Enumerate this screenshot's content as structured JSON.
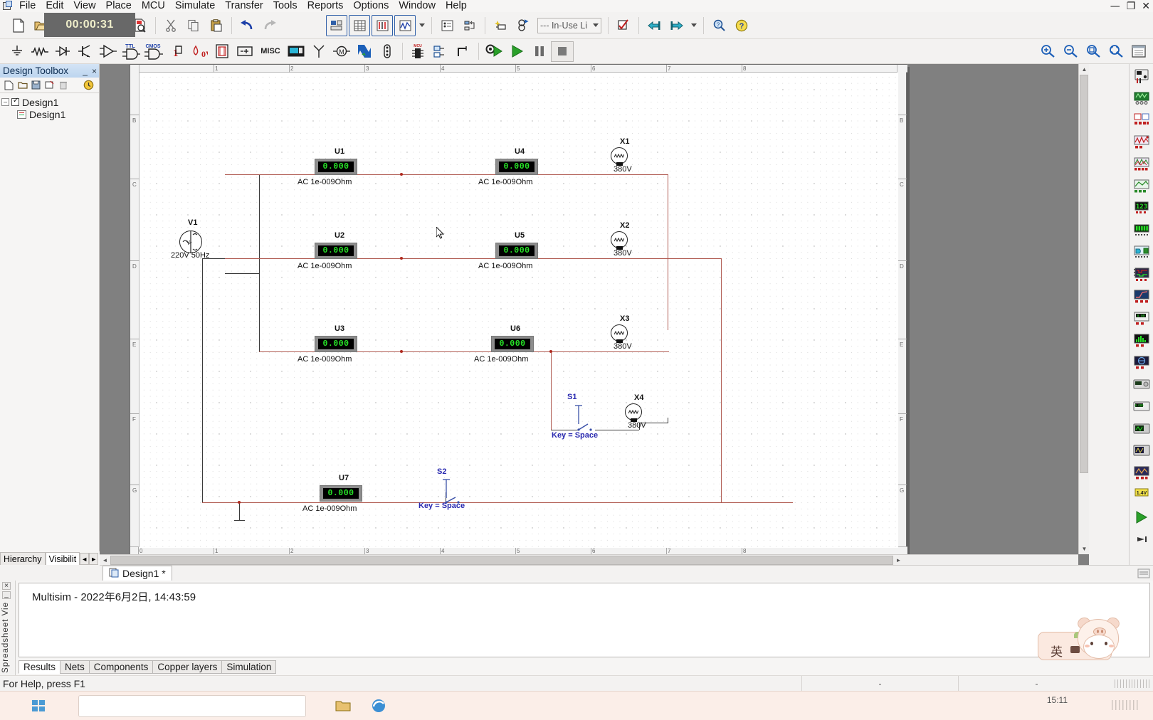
{
  "app": {
    "title": "Multisim",
    "icon": "multisim-app-icon"
  },
  "menu": {
    "items": [
      {
        "label": "File"
      },
      {
        "label": "Edit"
      },
      {
        "label": "View"
      },
      {
        "label": "Place"
      },
      {
        "label": "MCU"
      },
      {
        "label": "Simulate"
      },
      {
        "label": "Transfer"
      },
      {
        "label": "Tools"
      },
      {
        "label": "Reports"
      },
      {
        "label": "Options"
      },
      {
        "label": "Window"
      },
      {
        "label": "Help"
      }
    ]
  },
  "window_controls": {
    "minimize": "—",
    "restore": "❐",
    "close": "✕"
  },
  "timer": {
    "value": "00:00:31"
  },
  "toolbar_main": {
    "buttons": [
      {
        "name": "new-file",
        "icon": "new-document-icon"
      },
      {
        "name": "open-file",
        "icon": "open-folder-icon"
      },
      {
        "name": "open-samples",
        "icon": "open-samples-icon"
      },
      {
        "name": "save-file",
        "icon": "save-disk-icon"
      },
      {
        "name": "print",
        "icon": "printer-icon"
      },
      {
        "name": "print-preview",
        "icon": "print-preview-icon"
      },
      {
        "name": "cut",
        "icon": "scissors-icon"
      },
      {
        "name": "copy",
        "icon": "copy-icon"
      },
      {
        "name": "paste",
        "icon": "clipboard-paste-icon"
      },
      {
        "name": "undo",
        "icon": "undo-arrow-icon"
      },
      {
        "name": "redo",
        "icon": "redo-arrow-icon"
      },
      {
        "name": "toggle-design-toolbox",
        "icon": "design-toolbox-icon"
      },
      {
        "name": "toggle-spreadsheet-view",
        "icon": "spreadsheet-grid-icon"
      },
      {
        "name": "database-manager",
        "icon": "db-manager-icon"
      },
      {
        "name": "grapher",
        "icon": "grapher-waveform-icon"
      },
      {
        "name": "grapher-dropdown",
        "icon": "chevron-down-icon"
      },
      {
        "name": "postprocessor",
        "icon": "postprocessor-icon"
      },
      {
        "name": "electrical-rules-check",
        "icon": "erc-check-icon"
      },
      {
        "name": "back-annotate",
        "icon": "back-annotate-icon"
      },
      {
        "name": "create-component",
        "icon": "create-component-icon"
      },
      {
        "name": "in-use-list",
        "icon": "in-use-list-icon"
      },
      {
        "name": "help-search",
        "icon": "help-search-icon"
      }
    ],
    "in_use_list": {
      "value": "--- In-Use Li",
      "placeholder": "--- In-Use List ---"
    },
    "zoom": {
      "zoom_in": "zoom-in-icon",
      "zoom_out": "zoom-out-icon",
      "zoom_area": "zoom-area-icon",
      "zoom_fit": "zoom-fit-icon",
      "fullscreen": "fullscreen-icon"
    }
  },
  "toolbar_components": {
    "buttons": [
      {
        "name": "place-source",
        "icon": "source-ground-icon",
        "label": ""
      },
      {
        "name": "place-basic",
        "icon": "resistor-icon",
        "label": ""
      },
      {
        "name": "place-diode",
        "icon": "diode-icon",
        "label": ""
      },
      {
        "name": "place-transistor",
        "icon": "transistor-icon",
        "label": ""
      },
      {
        "name": "place-analog",
        "icon": "opamp-icon",
        "label": ""
      },
      {
        "name": "place-ttl",
        "icon": "ttl-gate-icon",
        "label": "TTL"
      },
      {
        "name": "place-cmos",
        "icon": "cmos-gate-icon",
        "label": "CMOS"
      },
      {
        "name": "place-misc-digital",
        "icon": "misc-digital-icon",
        "label": ""
      },
      {
        "name": "place-mixed",
        "icon": "mixed-component-icon",
        "label": "0V"
      },
      {
        "name": "place-indicator",
        "icon": "indicator-icon",
        "label": ""
      },
      {
        "name": "place-power",
        "icon": "power-source-icon",
        "label": ""
      },
      {
        "name": "place-misc",
        "icon": "misc-icon",
        "label": "MISC"
      },
      {
        "name": "place-advanced-peripherals",
        "icon": "peripherals-icon",
        "label": ""
      },
      {
        "name": "place-rf",
        "icon": "antenna-icon",
        "label": ""
      },
      {
        "name": "place-electromechanical",
        "icon": "motor-icon",
        "label": ""
      },
      {
        "name": "place-ni-components",
        "icon": "ni-logo-icon",
        "label": ""
      },
      {
        "name": "place-connectors",
        "icon": "connector-icon",
        "label": ""
      },
      {
        "name": "place-mcu",
        "icon": "mcu-chip-icon",
        "label": "MCU"
      },
      {
        "name": "place-hierarchical-block",
        "icon": "hierarchical-block-icon",
        "label": ""
      },
      {
        "name": "place-bus",
        "icon": "bus-icon",
        "label": ""
      },
      {
        "name": "simulation-settings",
        "icon": "simulate-settings-icon",
        "label": ""
      },
      {
        "name": "run-simulation",
        "icon": "run-play-icon",
        "label": ""
      },
      {
        "name": "pause-simulation",
        "icon": "pause-icon",
        "label": ""
      },
      {
        "name": "stop-simulation",
        "icon": "stop-icon",
        "label": ""
      }
    ]
  },
  "design_toolbox": {
    "title": "Design Toolbox",
    "tools": [
      {
        "name": "new-sheet",
        "icon": "new-sheet-icon"
      },
      {
        "name": "open-sheet",
        "icon": "open-sheet-icon"
      },
      {
        "name": "save-sheet",
        "icon": "save-sheet-icon"
      },
      {
        "name": "rename-sheet",
        "icon": "rename-sheet-icon"
      },
      {
        "name": "delete-sheet",
        "icon": "delete-sheet-icon"
      },
      {
        "name": "sheet-properties",
        "icon": "sheet-properties-icon"
      }
    ],
    "tree": [
      {
        "label": "Design1",
        "level": 0,
        "checked": true
      },
      {
        "label": "Design1",
        "level": 1,
        "checked": false
      }
    ],
    "tabs": [
      {
        "label": "Hierarchy",
        "active": false
      },
      {
        "label": "Visibilit",
        "active": true
      }
    ],
    "collapse_button": "_",
    "close_button": "×"
  },
  "schematic": {
    "ruler_top": [
      "1",
      "2",
      "3",
      "4",
      "5",
      "6",
      "7",
      "8"
    ],
    "ruler_bottom": [
      "0",
      "1",
      "2",
      "3",
      "4",
      "5",
      "6",
      "7",
      "8"
    ],
    "ruler_left": [
      "B",
      "C",
      "D",
      "E",
      "F",
      "G"
    ],
    "ruler_right": [
      "B",
      "C",
      "D",
      "E",
      "F",
      "G"
    ],
    "components": [
      {
        "name": "V1",
        "ref": "V1",
        "value": "220V 50Hz",
        "type": "ac-source"
      },
      {
        "name": "U1",
        "ref": "U1",
        "display": "0.000",
        "value": "AC  1e-009Ohm",
        "type": "multimeter"
      },
      {
        "name": "U2",
        "ref": "U2",
        "display": "0.000",
        "value": "AC  1e-009Ohm",
        "type": "multimeter"
      },
      {
        "name": "U3",
        "ref": "U3",
        "display": "0.000",
        "value": "AC  1e-009Ohm",
        "type": "multimeter"
      },
      {
        "name": "U4",
        "ref": "U4",
        "display": "0.000",
        "value": "AC  1e-009Ohm",
        "type": "multimeter"
      },
      {
        "name": "U5",
        "ref": "U5",
        "display": "0.000",
        "value": "AC  1e-009Ohm",
        "type": "multimeter"
      },
      {
        "name": "U6",
        "ref": "U6",
        "display": "0.000",
        "value": "AC  1e-009Ohm",
        "type": "multimeter"
      },
      {
        "name": "U7",
        "ref": "U7",
        "display": "0.000",
        "value": "AC  1e-009Ohm",
        "type": "multimeter"
      },
      {
        "name": "X1",
        "ref": "X1",
        "value": "380V",
        "type": "lamp"
      },
      {
        "name": "X2",
        "ref": "X2",
        "value": "380V",
        "type": "lamp"
      },
      {
        "name": "X3",
        "ref": "X3",
        "value": "380V",
        "type": "lamp"
      },
      {
        "name": "X4",
        "ref": "X4",
        "value": "380V",
        "type": "lamp"
      },
      {
        "name": "S1",
        "ref": "S1",
        "value": "Key = Space",
        "type": "switch"
      },
      {
        "name": "S2",
        "ref": "S2",
        "value": "Key = Space",
        "type": "switch"
      }
    ],
    "colors": {
      "wire": "#b05b52",
      "wire_dark": "#3a3a3a",
      "meter_display_text": "#27e327",
      "meter_display_bg": "#000000",
      "meter_body": "#8d8d8d",
      "label_blue": "#2a2ab0",
      "sheet_bg": "#ffffff",
      "workspace_bg": "#808080"
    }
  },
  "instruments_toolbar": {
    "buttons": [
      {
        "name": "multimeter",
        "icon": "multimeter-icon"
      },
      {
        "name": "function-generator",
        "icon": "function-generator-icon"
      },
      {
        "name": "wattmeter",
        "icon": "wattmeter-icon"
      },
      {
        "name": "oscilloscope",
        "icon": "oscilloscope-icon"
      },
      {
        "name": "four-channel-oscilloscope",
        "icon": "four-channel-scope-icon"
      },
      {
        "name": "bode-plotter",
        "icon": "bode-plotter-icon"
      },
      {
        "name": "frequency-counter",
        "icon": "frequency-counter-icon"
      },
      {
        "name": "word-generator",
        "icon": "word-generator-icon"
      },
      {
        "name": "logic-converter",
        "icon": "logic-converter-icon"
      },
      {
        "name": "logic-analyzer",
        "icon": "logic-analyzer-icon"
      },
      {
        "name": "iv-analyzer",
        "icon": "iv-analyzer-icon"
      },
      {
        "name": "distortion-analyzer",
        "icon": "distortion-analyzer-icon"
      },
      {
        "name": "spectrum-analyzer",
        "icon": "spectrum-analyzer-icon"
      },
      {
        "name": "network-analyzer",
        "icon": "network-analyzer-icon"
      },
      {
        "name": "agilent-function-generator",
        "icon": "agilent-fgen-icon"
      },
      {
        "name": "agilent-multimeter",
        "icon": "agilent-multimeter-icon"
      },
      {
        "name": "agilent-oscilloscope",
        "icon": "agilent-scope-icon"
      },
      {
        "name": "tektronix-oscilloscope",
        "icon": "tektronix-scope-icon"
      },
      {
        "name": "labview-instruments",
        "icon": "labview-instruments-icon"
      },
      {
        "name": "measurement-probe",
        "icon": "measurement-probe-icon"
      },
      {
        "name": "current-probe",
        "icon": "current-probe-icon"
      }
    ]
  },
  "design_tab": {
    "label": "Design1 *",
    "icon": "design-sheet-icon"
  },
  "spreadsheet_view": {
    "side_label": "Spreadsheet Vie",
    "close_button": "×",
    "collapse_button": "_",
    "content_line": "Multisim  -  2022年6月2日, 14:43:59",
    "tabs": [
      {
        "label": "Results",
        "active": true
      },
      {
        "label": "Nets",
        "active": false
      },
      {
        "label": "Components",
        "active": false
      },
      {
        "label": "Copper layers",
        "active": false
      },
      {
        "label": "Simulation",
        "active": false
      }
    ]
  },
  "status_bar": {
    "help_text": "For Help, press F1",
    "cell1": "-",
    "cell2": "-"
  },
  "taskbar": {
    "clock": "15:11"
  },
  "ime_widget": {
    "mode_label": "英",
    "name": "ime-floating-widget"
  }
}
